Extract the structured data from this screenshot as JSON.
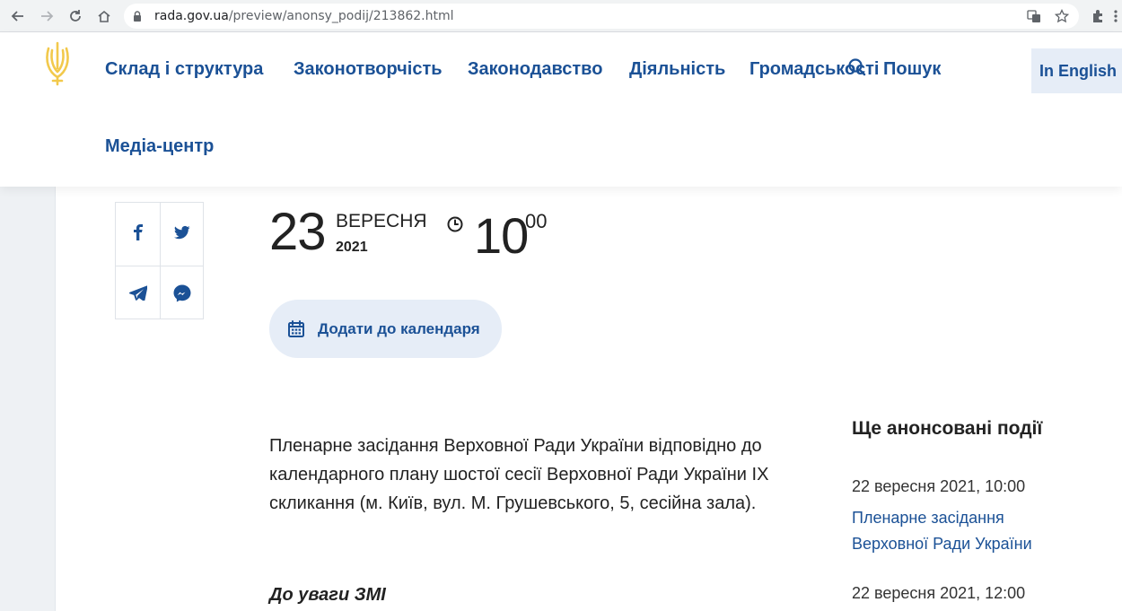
{
  "browser": {
    "url_host": "rada.gov.ua",
    "url_path": "/preview/anonsy_podij/213862.html"
  },
  "header": {
    "nav": [
      {
        "label": "Склад і структура"
      },
      {
        "label": "Законотворчість"
      },
      {
        "label": "Законодавство"
      },
      {
        "label": "Діяльність"
      },
      {
        "label": "Громадськості"
      },
      {
        "label": "Медіа-центр"
      }
    ],
    "search_label": "Пошук",
    "lang_label": "In English"
  },
  "event": {
    "day": "23",
    "month": "ВЕРЕСНЯ",
    "year": "2021",
    "hour": "10",
    "minute": "00",
    "calendar_button": "Додати до календаря",
    "description": "Пленарне засідання Верховної Ради України відповідно до календарного плану шостої сесії Верховної Ради України IX скликання (м. Київ, вул. М. Грушевського, 5, сесійна зала).",
    "media_note": "До уваги ЗМІ"
  },
  "sidebar": {
    "title": "Ще анонсовані події",
    "items": [
      {
        "date": "22 вересня 2021, 10:00",
        "title": "Пленарне засідання Верховної Ради України"
      },
      {
        "date": "22 вересня 2021, 12:00",
        "title": ""
      }
    ]
  },
  "colors": {
    "brand_blue": "#1b5196",
    "light_blue": "#e6edf7",
    "gold": "#f2c94c"
  }
}
